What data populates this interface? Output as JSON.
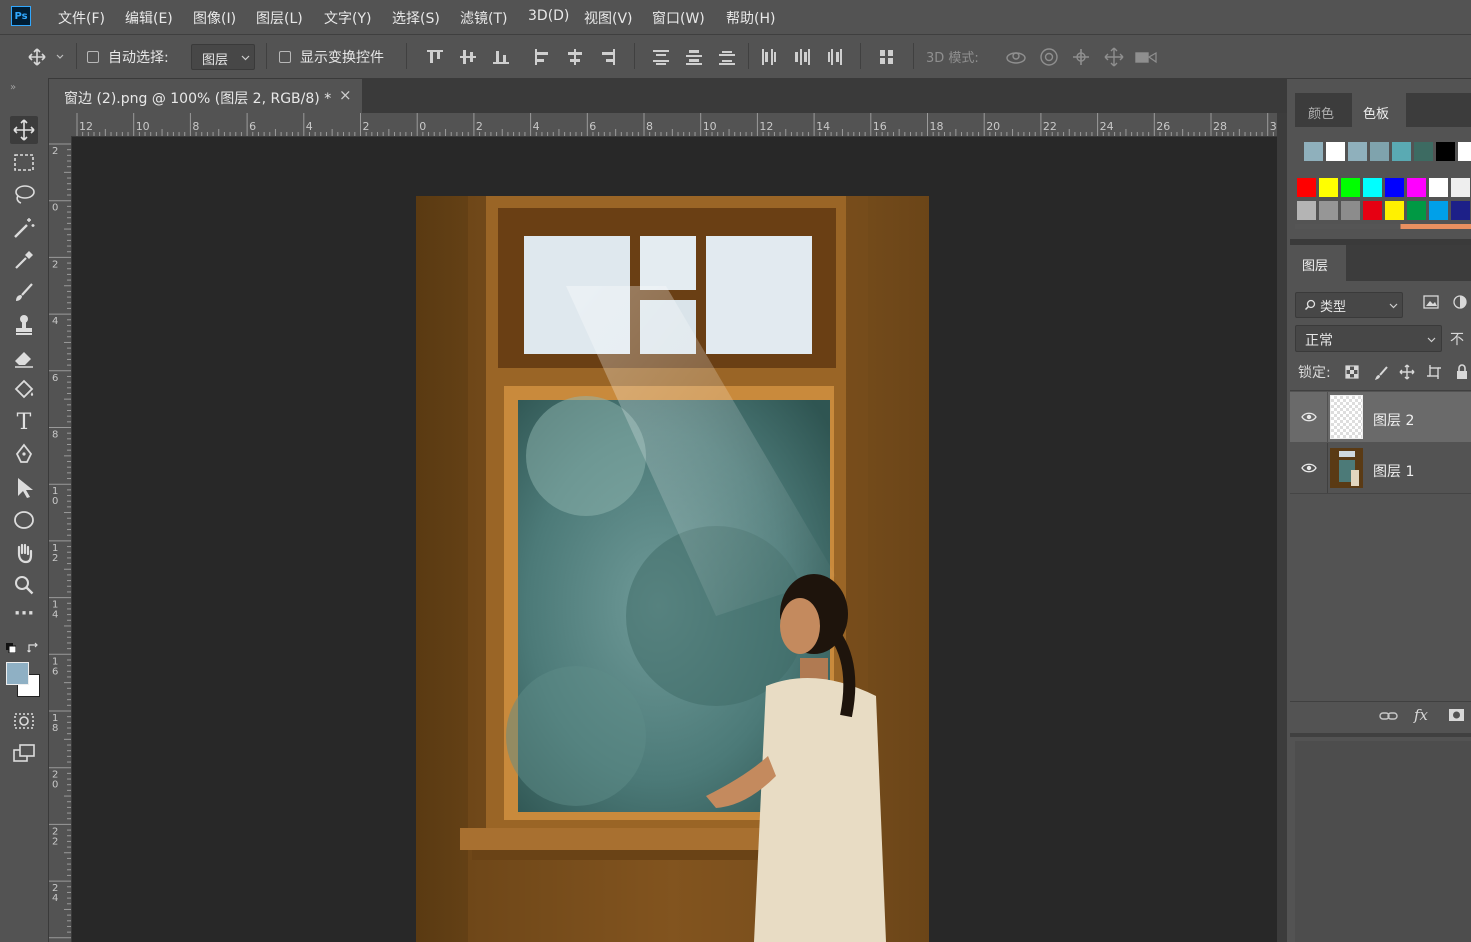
{
  "app": {
    "logo": "Ps",
    "brand_color": "#31a8ff"
  },
  "menu": {
    "file": "文件(F)",
    "edit": "编辑(E)",
    "image": "图像(I)",
    "layer": "图层(L)",
    "type": "文字(Y)",
    "select": "选择(S)",
    "filter": "滤镜(T)",
    "three_d": "3D(D)",
    "view": "视图(V)",
    "window": "窗口(W)",
    "help": "帮助(H)"
  },
  "options": {
    "auto_select_label": "自动选择:",
    "auto_select_target": "图层",
    "show_transform_label": "显示变换控件",
    "three_d_mode_label": "3D 模式:"
  },
  "document": {
    "tab_title": "窗边 (2).png @ 100% (图层 2, RGB/8) *",
    "close_symbol": "×"
  },
  "rulers": {
    "horizontal": [
      "12",
      "10",
      "8",
      "6",
      "4",
      "2",
      "0",
      "2",
      "4",
      "6",
      "8",
      "10",
      "12",
      "14",
      "16",
      "18",
      "20",
      "22",
      "24",
      "26",
      "28",
      "3"
    ],
    "vertical": [
      "2",
      "0",
      "2",
      "4",
      "6",
      "8",
      "1\n0",
      "1\n2",
      "1\n4",
      "1\n6",
      "1\n8",
      "2\n0",
      "2\n2",
      "2\n4"
    ]
  },
  "panels": {
    "color_tab": "颜色",
    "swatches_tab": "色板",
    "layers_tab": "图层",
    "filter_kind": "类型",
    "blend_mode": "正常",
    "opacity_partial": "不",
    "lock_label": "锁定:",
    "fx_label": "fx"
  },
  "swatches": {
    "row1": [
      "#8fb0bc",
      "#ffffff",
      "#8fb0bc",
      "#7fa3ad",
      "#5aaab3",
      "#3d6b62",
      "#000000",
      "#ffffff"
    ],
    "row2": [
      "#ff0000",
      "#ffff00",
      "#00ff00",
      "#00ffff",
      "#0000ff",
      "#ff00ff",
      "#ffffff",
      "#eeeeee"
    ],
    "row3": [
      "#b4b4b4",
      "#969696",
      "#8c8c8c",
      "#e60012",
      "#fff100",
      "#009944",
      "#00a0e9",
      "#1d2088"
    ]
  },
  "layers": [
    {
      "name": "图层 2",
      "selected": true
    },
    {
      "name": "图层 1",
      "selected": false
    }
  ],
  "colors": {
    "foreground": "#8fb0c4",
    "background": "#ffffff"
  }
}
